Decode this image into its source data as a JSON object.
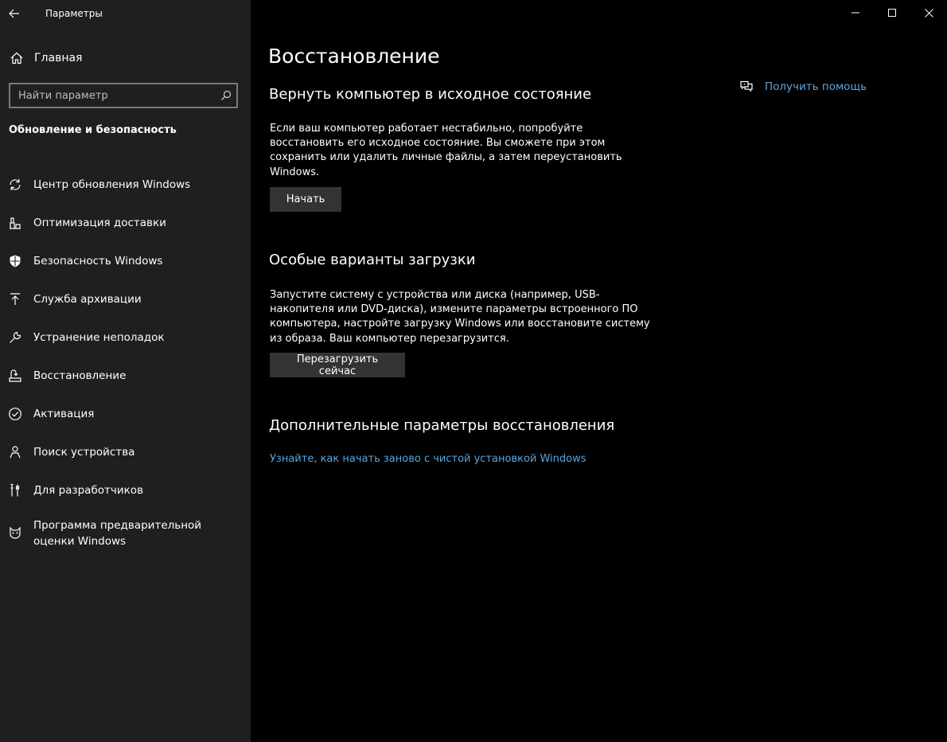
{
  "window": {
    "title": "Параметры"
  },
  "sidebar": {
    "home_label": "Главная",
    "search_placeholder": "Найти параметр",
    "section_title": "Обновление и безопасность",
    "items": [
      {
        "label": "Центр обновления Windows",
        "icon": "refresh-icon"
      },
      {
        "label": "Оптимизация доставки",
        "icon": "delivery-optimization-icon"
      },
      {
        "label": "Безопасность Windows",
        "icon": "shield-icon"
      },
      {
        "label": "Служба архивации",
        "icon": "backup-arrow-icon"
      },
      {
        "label": "Устранение неполадок",
        "icon": "wrench-icon"
      },
      {
        "label": "Восстановление",
        "icon": "recovery-icon"
      },
      {
        "label": "Активация",
        "icon": "check-circle-icon"
      },
      {
        "label": "Поиск устройства",
        "icon": "person-location-icon"
      },
      {
        "label": "Для разработчиков",
        "icon": "developer-tools-icon"
      },
      {
        "label": "Программа предварительной оценки Windows",
        "icon": "insider-cat-icon"
      }
    ]
  },
  "main": {
    "page_title": "Восстановление",
    "help_label": "Получить помощь",
    "reset": {
      "heading": "Вернуть компьютер в исходное состояние",
      "text_lines": [
        "Если ваш компьютер работает нестабильно, попробуйте",
        "восстановить его исходное состояние. Вы сможете при этом",
        "сохранить или удалить личные файлы, а затем переустановить",
        "Windows."
      ],
      "button_label": "Начать"
    },
    "advanced_startup": {
      "heading": "Особые варианты загрузки",
      "text_lines": [
        "Запустите систему с устройства или диска (например, USB-",
        "накопителя или DVD-диска), измените параметры встроенного ПО",
        "компьютера, настройте загрузку Windows или восстановите систему",
        "из образа. Ваш компьютер перезагрузится."
      ],
      "button_label": "Перезагрузить сейчас"
    },
    "more_options": {
      "heading": "Дополнительные параметры восстановления",
      "link_label": "Узнайте, как начать заново с чистой установкой Windows"
    }
  },
  "colors": {
    "sidebar_bg": "#1f1f1f",
    "main_bg": "#000000",
    "accent_link": "#5ba4dc",
    "button_bg": "#333333"
  }
}
